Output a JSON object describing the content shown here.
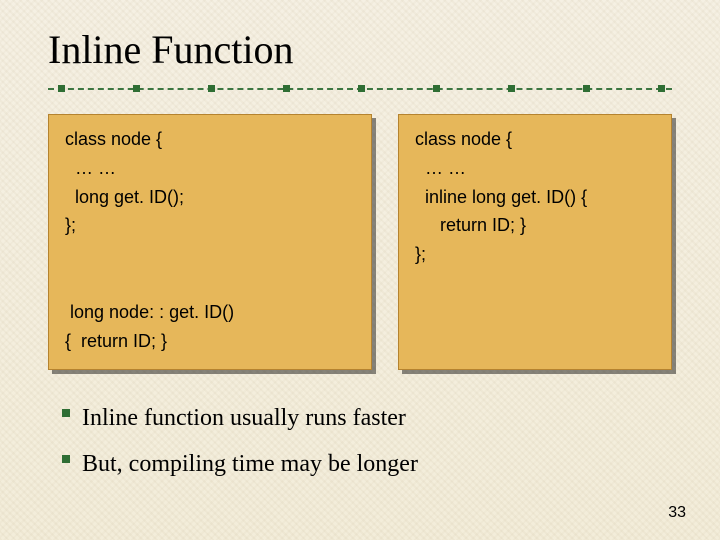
{
  "title": "Inline Function",
  "code_left": "class node {\n  … …\n  long get. ID();\n};\n\n\n long node: : get. ID()\n{  return ID; }",
  "code_right": "class node {\n  … …\n  inline long get. ID() {\n     return ID; }\n};",
  "notes": {
    "line1": "Inline function usually runs faster",
    "line2": "But, compiling time may be longer"
  },
  "page_number": "33"
}
